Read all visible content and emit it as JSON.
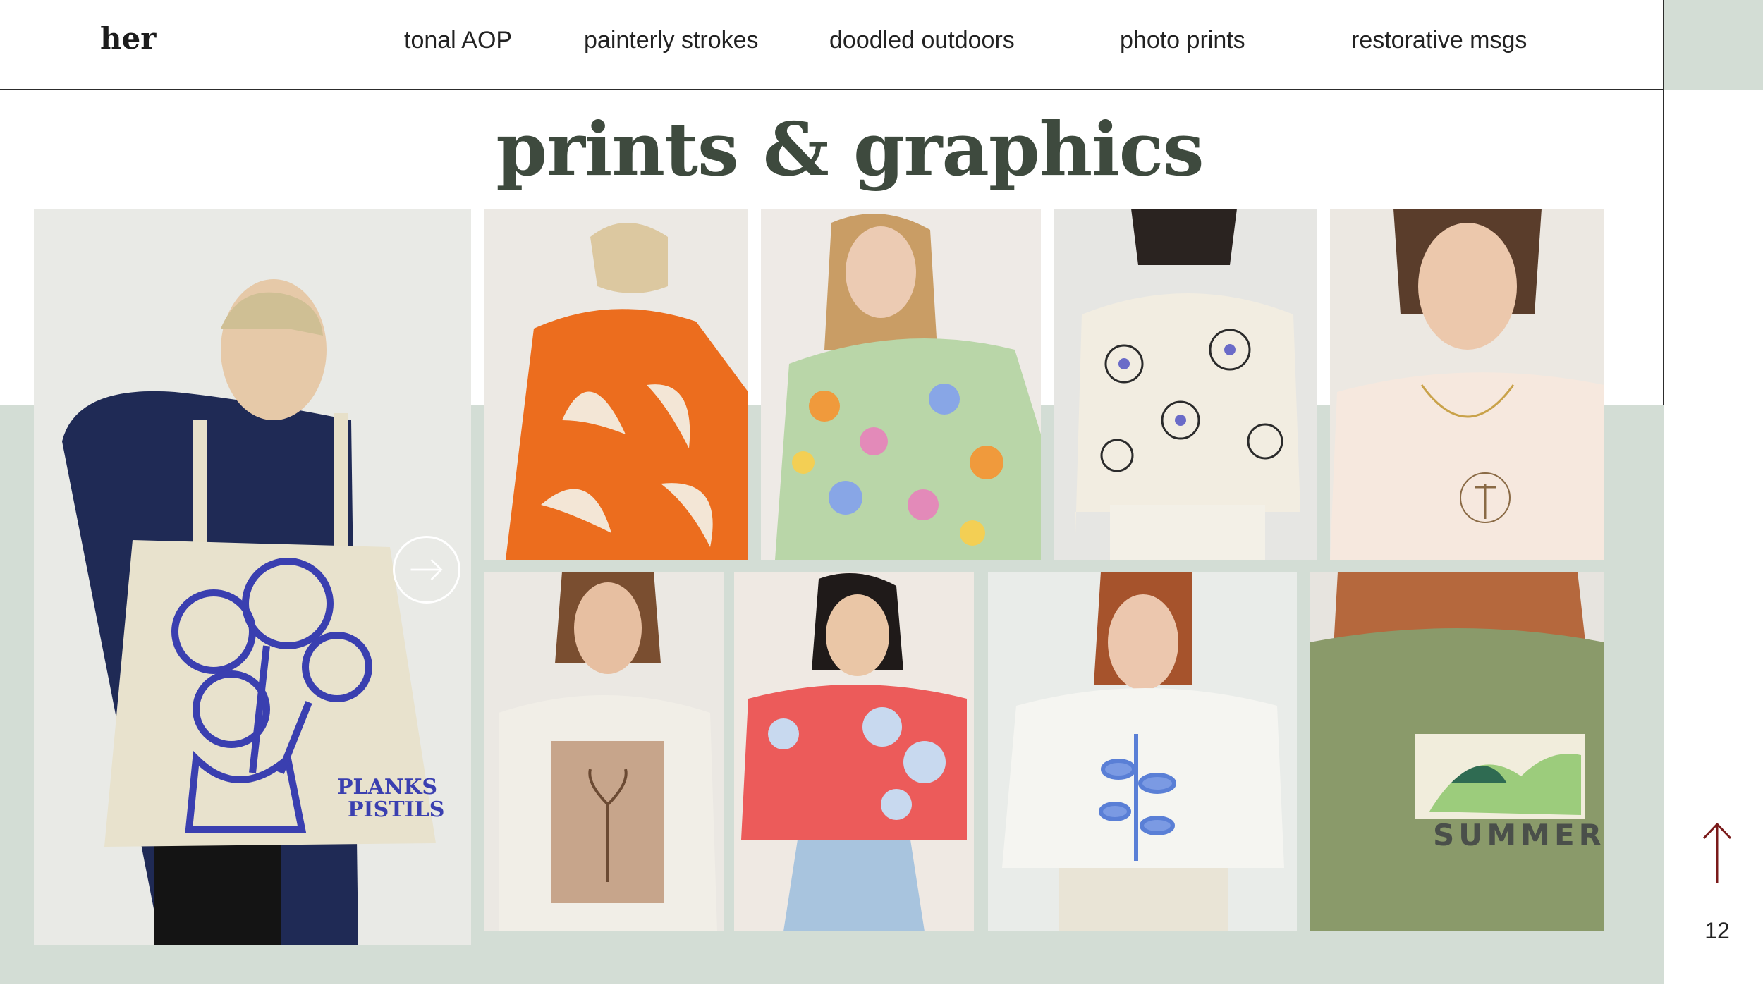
{
  "header": {
    "brand": "her",
    "nav": [
      "tonal AOP",
      "painterly strokes",
      "doodled outdoors",
      "photo prints",
      "restorative msgs"
    ]
  },
  "page": {
    "title": "prints & graphics",
    "page_number": "12"
  },
  "gallery": {
    "tote_text": [
      "PLANKS",
      "PISTILS"
    ],
    "tee_print_text": "SUMMER"
  },
  "colors": {
    "band": "#d3ddd5",
    "title": "#3e4a3e",
    "arrow": "#7a1a1a",
    "tote_ink": "#3a3fb0"
  },
  "icons": {
    "next": "arrow-right-circle-icon",
    "top": "arrow-up-icon"
  }
}
